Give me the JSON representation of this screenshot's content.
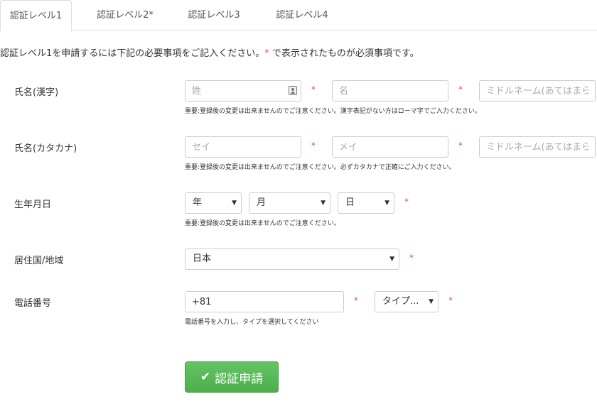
{
  "tabs": [
    {
      "label": "認証レベル1",
      "active": true
    },
    {
      "label": "認証レベル2*",
      "active": false
    },
    {
      "label": "認証レベル3",
      "active": false
    },
    {
      "label": "認証レベル4",
      "active": false
    }
  ],
  "intro": {
    "text": "認証レベル1を申請するには下記の必要事項をご記入ください。",
    "star": "*",
    "suffix": " で表示されたものが必須事項です。"
  },
  "required_mark": "*",
  "name_kanji": {
    "label": "氏名(漢字)",
    "last_placeholder": "姓",
    "first_placeholder": "名",
    "middle_placeholder": "ミドルネーム(あてはまらな",
    "help": "重要:登録後の変更は出来ませんのでご注意ください。漢字表記がない方はローマ字でご入力ください。"
  },
  "name_kana": {
    "label": "氏名(カタカナ)",
    "last_placeholder": "セイ",
    "first_placeholder": "メイ",
    "middle_placeholder": "ミドルネーム(あてはまらな",
    "help": "重要:登録後の変更は出来ませんのでご注意ください。必ずカタカナで正確にご入力ください。"
  },
  "birthdate": {
    "label": "生年月日",
    "year": "年",
    "month": "月",
    "day": "日",
    "help": "重要:登録後の変更は出来ませんのでご注意ください。"
  },
  "country": {
    "label": "居住国/地域",
    "value": "日本"
  },
  "phone": {
    "label": "電話番号",
    "value": "+81",
    "type": "タイプ...",
    "help": "電話番号を入力し、タイプを選択してください"
  },
  "submit": {
    "label": "認証申請",
    "icon": "check-icon",
    "color": "#5cb85c"
  },
  "colors": {
    "required": "#d9534f",
    "border": "#cccccc"
  }
}
